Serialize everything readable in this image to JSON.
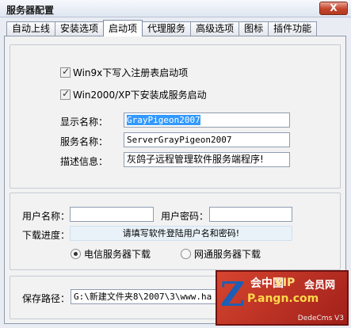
{
  "window": {
    "title": "服务器配置",
    "close_label": "X"
  },
  "tabs": [
    {
      "label": "自动上线"
    },
    {
      "label": "安装选项"
    },
    {
      "label": "启动项"
    },
    {
      "label": "代理服务"
    },
    {
      "label": "高级选项"
    },
    {
      "label": "图标"
    },
    {
      "label": "插件功能"
    }
  ],
  "active_tab": "启动项",
  "startup": {
    "check_registry_label": "Win9x下写入注册表启动项",
    "check_registry_checked": true,
    "check_service_label": "Win2000/XP下安装成服务启动",
    "check_service_checked": true,
    "display_name_label": "显示名称：",
    "display_name_value": "GrayPigeon2007",
    "service_name_label": "服务名称：",
    "service_name_value": "ServerGrayPigeon2007",
    "description_label": "描述信息：",
    "description_value": "灰鸽子远程管理软件服务端程序!"
  },
  "download": {
    "username_label": "用户名称：",
    "username_value": "",
    "password_label": "用户密码：",
    "password_value": "",
    "progress_label": "下载进度：",
    "progress_text": "请填写软件登陆用户名和密码!",
    "radio_telecom_label": "电信服务器下载",
    "radio_telecom_selected": true,
    "radio_netcom_label": "网通服务器下载",
    "radio_netcom_selected": false
  },
  "save": {
    "path_label": "保存路径：",
    "path_value": "G:\\新建文件夹8\\2007\\3\\www.ha"
  },
  "watermark": {
    "logo_letter": "Z",
    "club_text": "会中国",
    "vip_text": "VIP",
    "member_text": "会员网",
    "site_text": "P.angn.com",
    "cms_text": "DedeCms V3"
  }
}
